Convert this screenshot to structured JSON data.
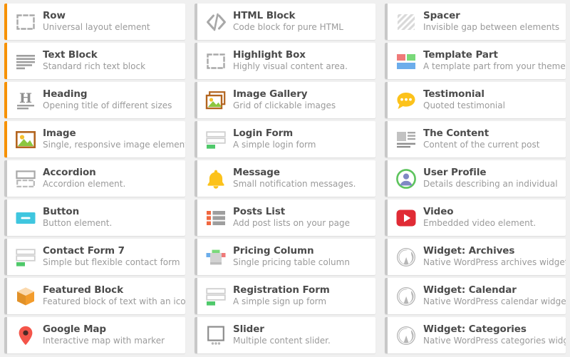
{
  "background_color": "#f0f0f0",
  "card_color": "#ffffff",
  "accent_colors": {
    "active": "#f79100",
    "inactive": "#c8c8c8"
  },
  "columns": 3,
  "elements": [
    {
      "title": "Row",
      "subtitle": "Universal layout element",
      "icon": "dashed-box-icon",
      "accent": "orange"
    },
    {
      "title": "HTML Block",
      "subtitle": "Code block for pure HTML",
      "icon": "code-brackets-icon",
      "accent": "gray"
    },
    {
      "title": "Spacer",
      "subtitle": "Invisible gap between elements",
      "icon": "diagonal-stripes-icon",
      "accent": "gray"
    },
    {
      "title": "Text Block",
      "subtitle": "Standard rich text block",
      "icon": "text-lines-icon",
      "accent": "orange"
    },
    {
      "title": "Highlight Box",
      "subtitle": "Highly visual content area.",
      "icon": "dashed-box-icon",
      "accent": "gray"
    },
    {
      "title": "Template Part",
      "subtitle": "A template part from your theme",
      "icon": "template-blocks-icon",
      "accent": "gray"
    },
    {
      "title": "Heading",
      "subtitle": "Opening title of different sizes",
      "icon": "heading-h-icon",
      "accent": "orange"
    },
    {
      "title": "Image Gallery",
      "subtitle": "Grid of clickable images",
      "icon": "gallery-stack-icon",
      "accent": "gray"
    },
    {
      "title": "Testimonial",
      "subtitle": "Quoted testimonial",
      "icon": "speech-bubble-icon",
      "accent": "gray"
    },
    {
      "title": "Image",
      "subtitle": "Single, responsive image element.",
      "icon": "picture-frame-icon",
      "accent": "orange"
    },
    {
      "title": "Login Form",
      "subtitle": "A simple login form",
      "icon": "form-fields-icon",
      "accent": "gray"
    },
    {
      "title": "The Content",
      "subtitle": "Content of the current post",
      "icon": "content-block-icon",
      "accent": "gray"
    },
    {
      "title": "Accordion",
      "subtitle": "Accordion element.",
      "icon": "accordion-panels-icon",
      "accent": "gray"
    },
    {
      "title": "Message",
      "subtitle": "Small notification messages.",
      "icon": "bell-icon",
      "accent": "gray"
    },
    {
      "title": "User Profile",
      "subtitle": "Details describing an individual",
      "icon": "user-circle-icon",
      "accent": "gray"
    },
    {
      "title": "Button",
      "subtitle": "Button element.",
      "icon": "button-icon",
      "accent": "gray"
    },
    {
      "title": "Posts List",
      "subtitle": "Add post lists on your page",
      "icon": "posts-list-icon",
      "accent": "gray"
    },
    {
      "title": "Video",
      "subtitle": "Embedded video element.",
      "icon": "play-button-icon",
      "accent": "gray"
    },
    {
      "title": "Contact Form 7",
      "subtitle": "Simple but flexible contact form",
      "icon": "form-fields-icon",
      "accent": "gray"
    },
    {
      "title": "Pricing Column",
      "subtitle": "Single pricing table column",
      "icon": "pricing-column-icon",
      "accent": "gray"
    },
    {
      "title": "Widget: Archives",
      "subtitle": "Native WordPress archives widget",
      "icon": "wordpress-icon",
      "accent": "gray"
    },
    {
      "title": "Featured Block",
      "subtitle": "Featured block of text with an icon",
      "icon": "cube-icon",
      "accent": "gray"
    },
    {
      "title": "Registration Form",
      "subtitle": "A simple sign up form",
      "icon": "form-fields-icon",
      "accent": "gray"
    },
    {
      "title": "Widget: Calendar",
      "subtitle": "Native WordPress calendar widget",
      "icon": "wordpress-icon",
      "accent": "gray"
    },
    {
      "title": "Google Map",
      "subtitle": "Interactive map with marker",
      "icon": "map-pin-icon",
      "accent": "gray"
    },
    {
      "title": "Slider",
      "subtitle": "Multiple content slider.",
      "icon": "slider-icon",
      "accent": "gray"
    },
    {
      "title": "Widget: Categories",
      "subtitle": "Native WordPress categories widget",
      "icon": "wordpress-icon",
      "accent": "gray"
    }
  ]
}
